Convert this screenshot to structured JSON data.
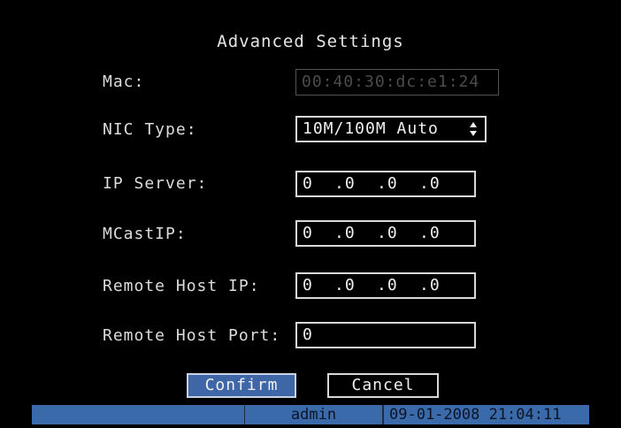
{
  "dialog": {
    "title": "Advanced Settings"
  },
  "fields": {
    "mac": {
      "label": "Mac:",
      "value": "00:40:30:dc:e1:24"
    },
    "nic_type": {
      "label": "NIC Type:",
      "value": "10M/100M Auto"
    },
    "ip_server": {
      "label": "IP Server:",
      "octets": [
        "0",
        ".0",
        ".0",
        ".0"
      ]
    },
    "mcast_ip": {
      "label": "MCastIP:",
      "octets": [
        "0",
        ".0",
        ".0",
        ".0"
      ]
    },
    "remote_host_ip": {
      "label": "Remote Host IP:",
      "octets": [
        "0",
        ".0",
        ".0",
        ".0"
      ]
    },
    "remote_host_port": {
      "label": "Remote Host Port:",
      "value": "0"
    }
  },
  "buttons": {
    "confirm": "Confirm",
    "cancel": "Cancel"
  },
  "statusbar": {
    "user": "admin",
    "datetime": "09-01-2008 21:04:11"
  },
  "colors": {
    "background": "#000000",
    "accent": "#3f67a8",
    "statusbar": "#3b6aaa",
    "text": "#e6e6e6"
  }
}
